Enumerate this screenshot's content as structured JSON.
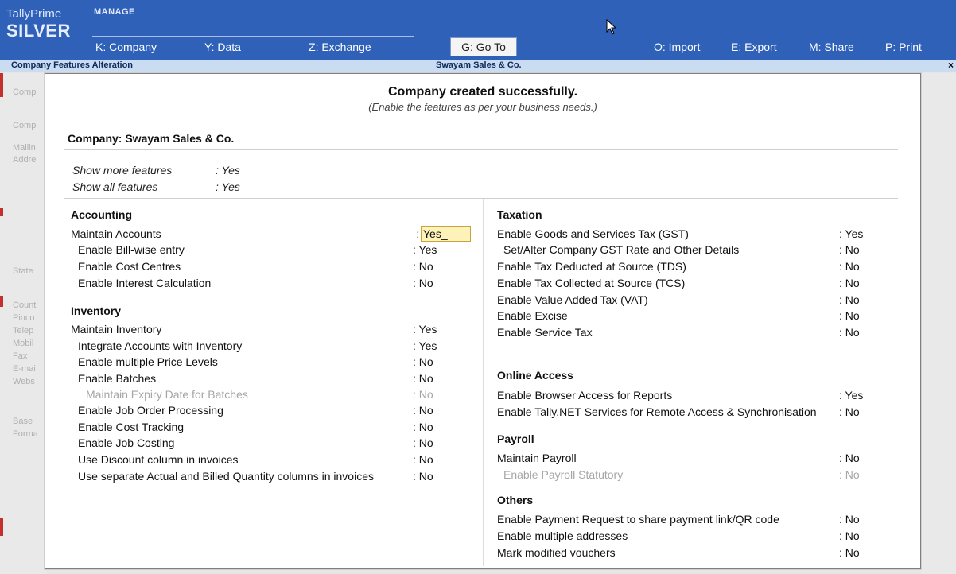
{
  "topbar": {
    "brand_top": "TallyPrime",
    "brand_main": "SILVER",
    "section": "MANAGE",
    "menu": [
      {
        "key": "K",
        "label": ": Company"
      },
      {
        "key": "Y",
        "label": ": Data"
      },
      {
        "key": "Z",
        "label": ": Exchange"
      },
      {
        "key": "G",
        "label": ": Go To"
      },
      {
        "key": "O",
        "label": ": Import"
      },
      {
        "key": "E",
        "label": ": Export"
      },
      {
        "key": "M",
        "label": ": Share"
      },
      {
        "key": "P",
        "label": ": Print"
      }
    ]
  },
  "titlestrip": {
    "left": "Company Features  Alteration",
    "center": "Swayam Sales & Co.",
    "close": "×"
  },
  "background_labels": [
    "Comp",
    "Comp",
    "Mailin",
    "Addre",
    "State",
    "Count",
    "Pinco",
    "Telep",
    "Mobil",
    "Fax",
    "E-mai",
    "Webs",
    "Base",
    "Forma"
  ],
  "dialog": {
    "title": "Company created successfully.",
    "subtitle": "(Enable the features as per your business needs.)",
    "company": "Company: Swayam Sales & Co.",
    "show_more": {
      "label": "Show more features",
      "value": ": Yes"
    },
    "show_all": {
      "label": "Show all features",
      "value": ": Yes"
    },
    "accounting": {
      "title": "Accounting",
      "rows": [
        {
          "label": "Maintain Accounts",
          "value": "Yes_",
          "active": true
        },
        {
          "label": "Enable Bill-wise entry",
          "value": ": Yes"
        },
        {
          "label": "Enable Cost Centres",
          "value": ": No"
        },
        {
          "label": "Enable Interest Calculation",
          "value": ": No"
        }
      ]
    },
    "inventory": {
      "title": "Inventory",
      "rows": [
        {
          "label": "Maintain Inventory",
          "value": ": Yes"
        },
        {
          "label": "Integrate Accounts with Inventory",
          "value": ": Yes"
        },
        {
          "label": "Enable multiple Price Levels",
          "value": ": No"
        },
        {
          "label": "Enable Batches",
          "value": ": No"
        },
        {
          "label": "Maintain Expiry Date for Batches",
          "value": ": No"
        },
        {
          "label": "Enable Job Order Processing",
          "value": ": No"
        },
        {
          "label": "Enable Cost Tracking",
          "value": ": No"
        },
        {
          "label": "Enable Job Costing",
          "value": ": No"
        },
        {
          "label": "Use Discount column in invoices",
          "value": ": No"
        },
        {
          "label": "Use separate Actual and Billed Quantity columns in invoices",
          "value": ": No"
        }
      ]
    },
    "taxation": {
      "title": "Taxation",
      "rows": [
        {
          "label": "Enable Goods and Services Tax (GST)",
          "value": ": Yes"
        },
        {
          "label": "Set/Alter Company GST Rate and Other Details",
          "value": ": No"
        },
        {
          "label": "Enable Tax Deducted at Source (TDS)",
          "value": ": No"
        },
        {
          "label": "Enable Tax Collected at Source (TCS)",
          "value": ": No"
        },
        {
          "label": "Enable Value Added Tax (VAT)",
          "value": ": No"
        },
        {
          "label": "Enable Excise",
          "value": ": No"
        },
        {
          "label": "Enable Service Tax",
          "value": ": No"
        }
      ]
    },
    "online": {
      "title": "Online Access",
      "rows": [
        {
          "label": "Enable Browser Access for Reports",
          "value": ": Yes"
        },
        {
          "label": "Enable Tally.NET Services for Remote Access & Synchronisation",
          "value": ": No"
        }
      ]
    },
    "payroll": {
      "title": "Payroll",
      "rows": [
        {
          "label": "Maintain Payroll",
          "value": ": No"
        },
        {
          "label": "Enable Payroll Statutory",
          "value": ": No"
        }
      ]
    },
    "others": {
      "title": "Others",
      "rows": [
        {
          "label": "Enable Payment Request to share payment link/QR code",
          "value": ": No"
        },
        {
          "label": "Enable multiple addresses",
          "value": ": No"
        },
        {
          "label": "Mark modified vouchers",
          "value": ": No"
        }
      ]
    }
  }
}
